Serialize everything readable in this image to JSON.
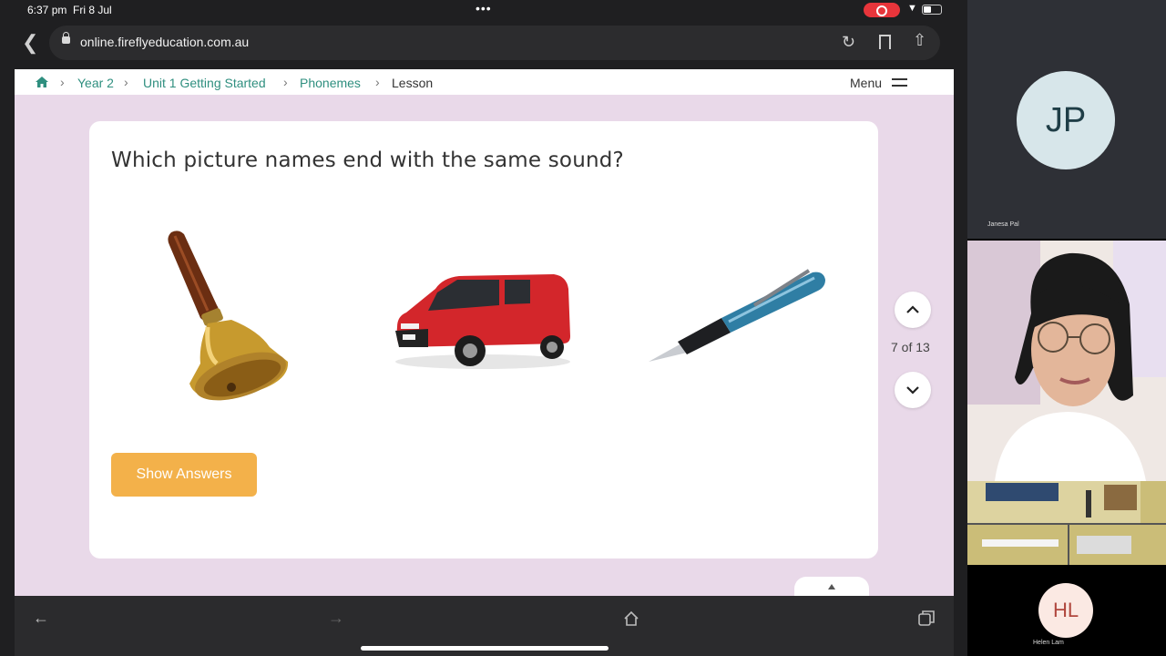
{
  "status_bar": {
    "time": "6:37 pm",
    "date": "Fri 8 Jul",
    "dots": "•••"
  },
  "browser": {
    "url": "online.fireflyeducation.com.au",
    "icons": [
      "back-icon",
      "lock-icon",
      "reload-icon",
      "bookmark-icon",
      "share-icon"
    ]
  },
  "breadcrumb": {
    "items": [
      "Year 2",
      "Unit 1 Getting Started",
      "Phonemes"
    ],
    "current": "Lesson",
    "menu_label": "Menu"
  },
  "lesson": {
    "question": "Which picture names end with the same sound?",
    "pictures": [
      "bell",
      "van",
      "pen"
    ],
    "show_answers_label": "Show Answers",
    "slide_counter": "7 of 13"
  },
  "participants": [
    {
      "initials": "JP",
      "name": "Janesa Pal"
    },
    {
      "initials": "HL",
      "name": "Helen Lam"
    }
  ],
  "colors": {
    "accent_teal": "#2f8f7f",
    "page_bg": "#e9d9e9",
    "button_orange": "#f3b14a"
  }
}
